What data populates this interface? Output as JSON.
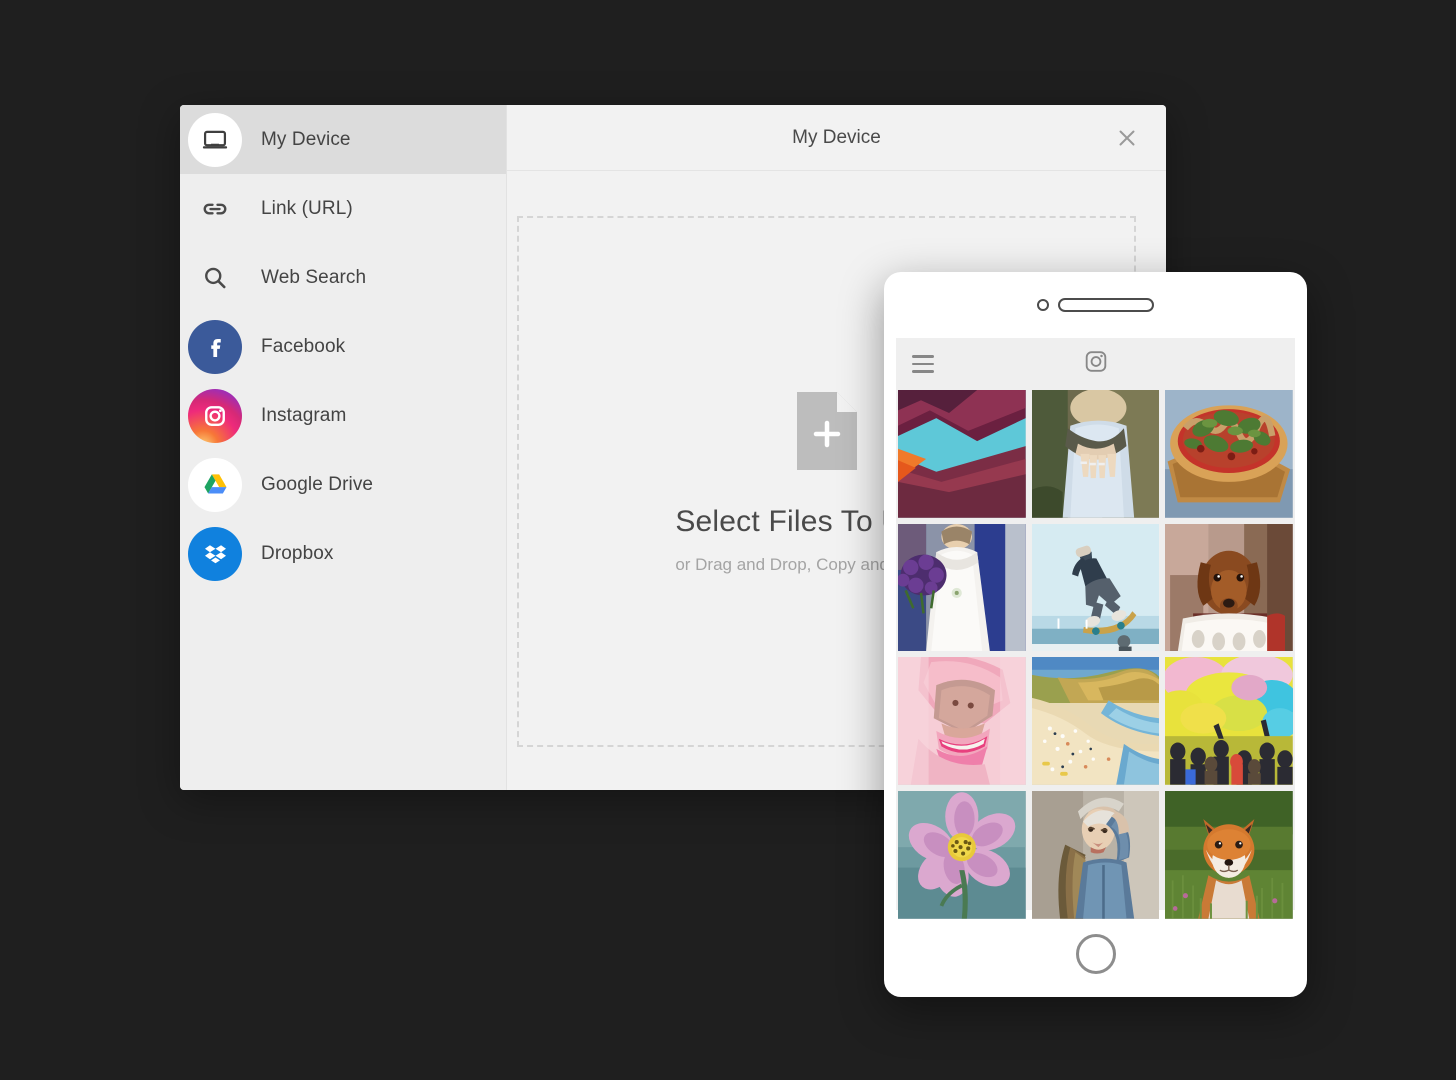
{
  "background_color": "#1f1f1f",
  "dialog": {
    "header": {
      "title": "My Device",
      "close_label": "close-icon"
    },
    "sidebar": {
      "items": [
        {
          "label": "My Device",
          "icon": "laptop-icon",
          "active": true
        },
        {
          "label": "Link (URL)",
          "icon": "link-icon",
          "active": false
        },
        {
          "label": "Web Search",
          "icon": "search-icon",
          "active": false
        },
        {
          "label": "Facebook",
          "icon": "facebook-icon",
          "active": false,
          "color": "#3b5a9a"
        },
        {
          "label": "Instagram",
          "icon": "instagram-icon",
          "active": false,
          "color": "#ee2a7b"
        },
        {
          "label": "Google Drive",
          "icon": "google-drive-icon",
          "active": false,
          "color": "#ffffff"
        },
        {
          "label": "Dropbox",
          "icon": "dropbox-icon",
          "active": false,
          "color": "#1081de"
        }
      ]
    },
    "dropzone": {
      "icon": "file-plus-icon",
      "title": "Select Files To Upload",
      "subtitle": "or Drag and Drop, Copy and Paste Files"
    }
  },
  "phone": {
    "hardware": {
      "camera": "camera-dot",
      "speaker": "speaker-grill",
      "home_button": "home-button"
    },
    "app_bar": {
      "menu_icon": "hamburger-menu-icon",
      "logo_icon": "instagram-camera-icon"
    },
    "photos": [
      {
        "id": 1,
        "name": "canyon-landscape-illustration"
      },
      {
        "id": 2,
        "name": "hands-with-rings-woman"
      },
      {
        "id": 3,
        "name": "pizza-on-wooden-board"
      },
      {
        "id": 4,
        "name": "bride-with-bouquet"
      },
      {
        "id": 5,
        "name": "skateboarder-midair"
      },
      {
        "id": 6,
        "name": "dog-in-laundry-basket"
      },
      {
        "id": 7,
        "name": "woman-pink-lips-portrait"
      },
      {
        "id": 8,
        "name": "beach-cove-aerial"
      },
      {
        "id": 9,
        "name": "holi-color-festival-crowd"
      },
      {
        "id": 10,
        "name": "pink-cosmos-flower"
      },
      {
        "id": 11,
        "name": "woman-denim-jacket-portrait"
      },
      {
        "id": 12,
        "name": "red-fox-in-grass"
      }
    ]
  }
}
